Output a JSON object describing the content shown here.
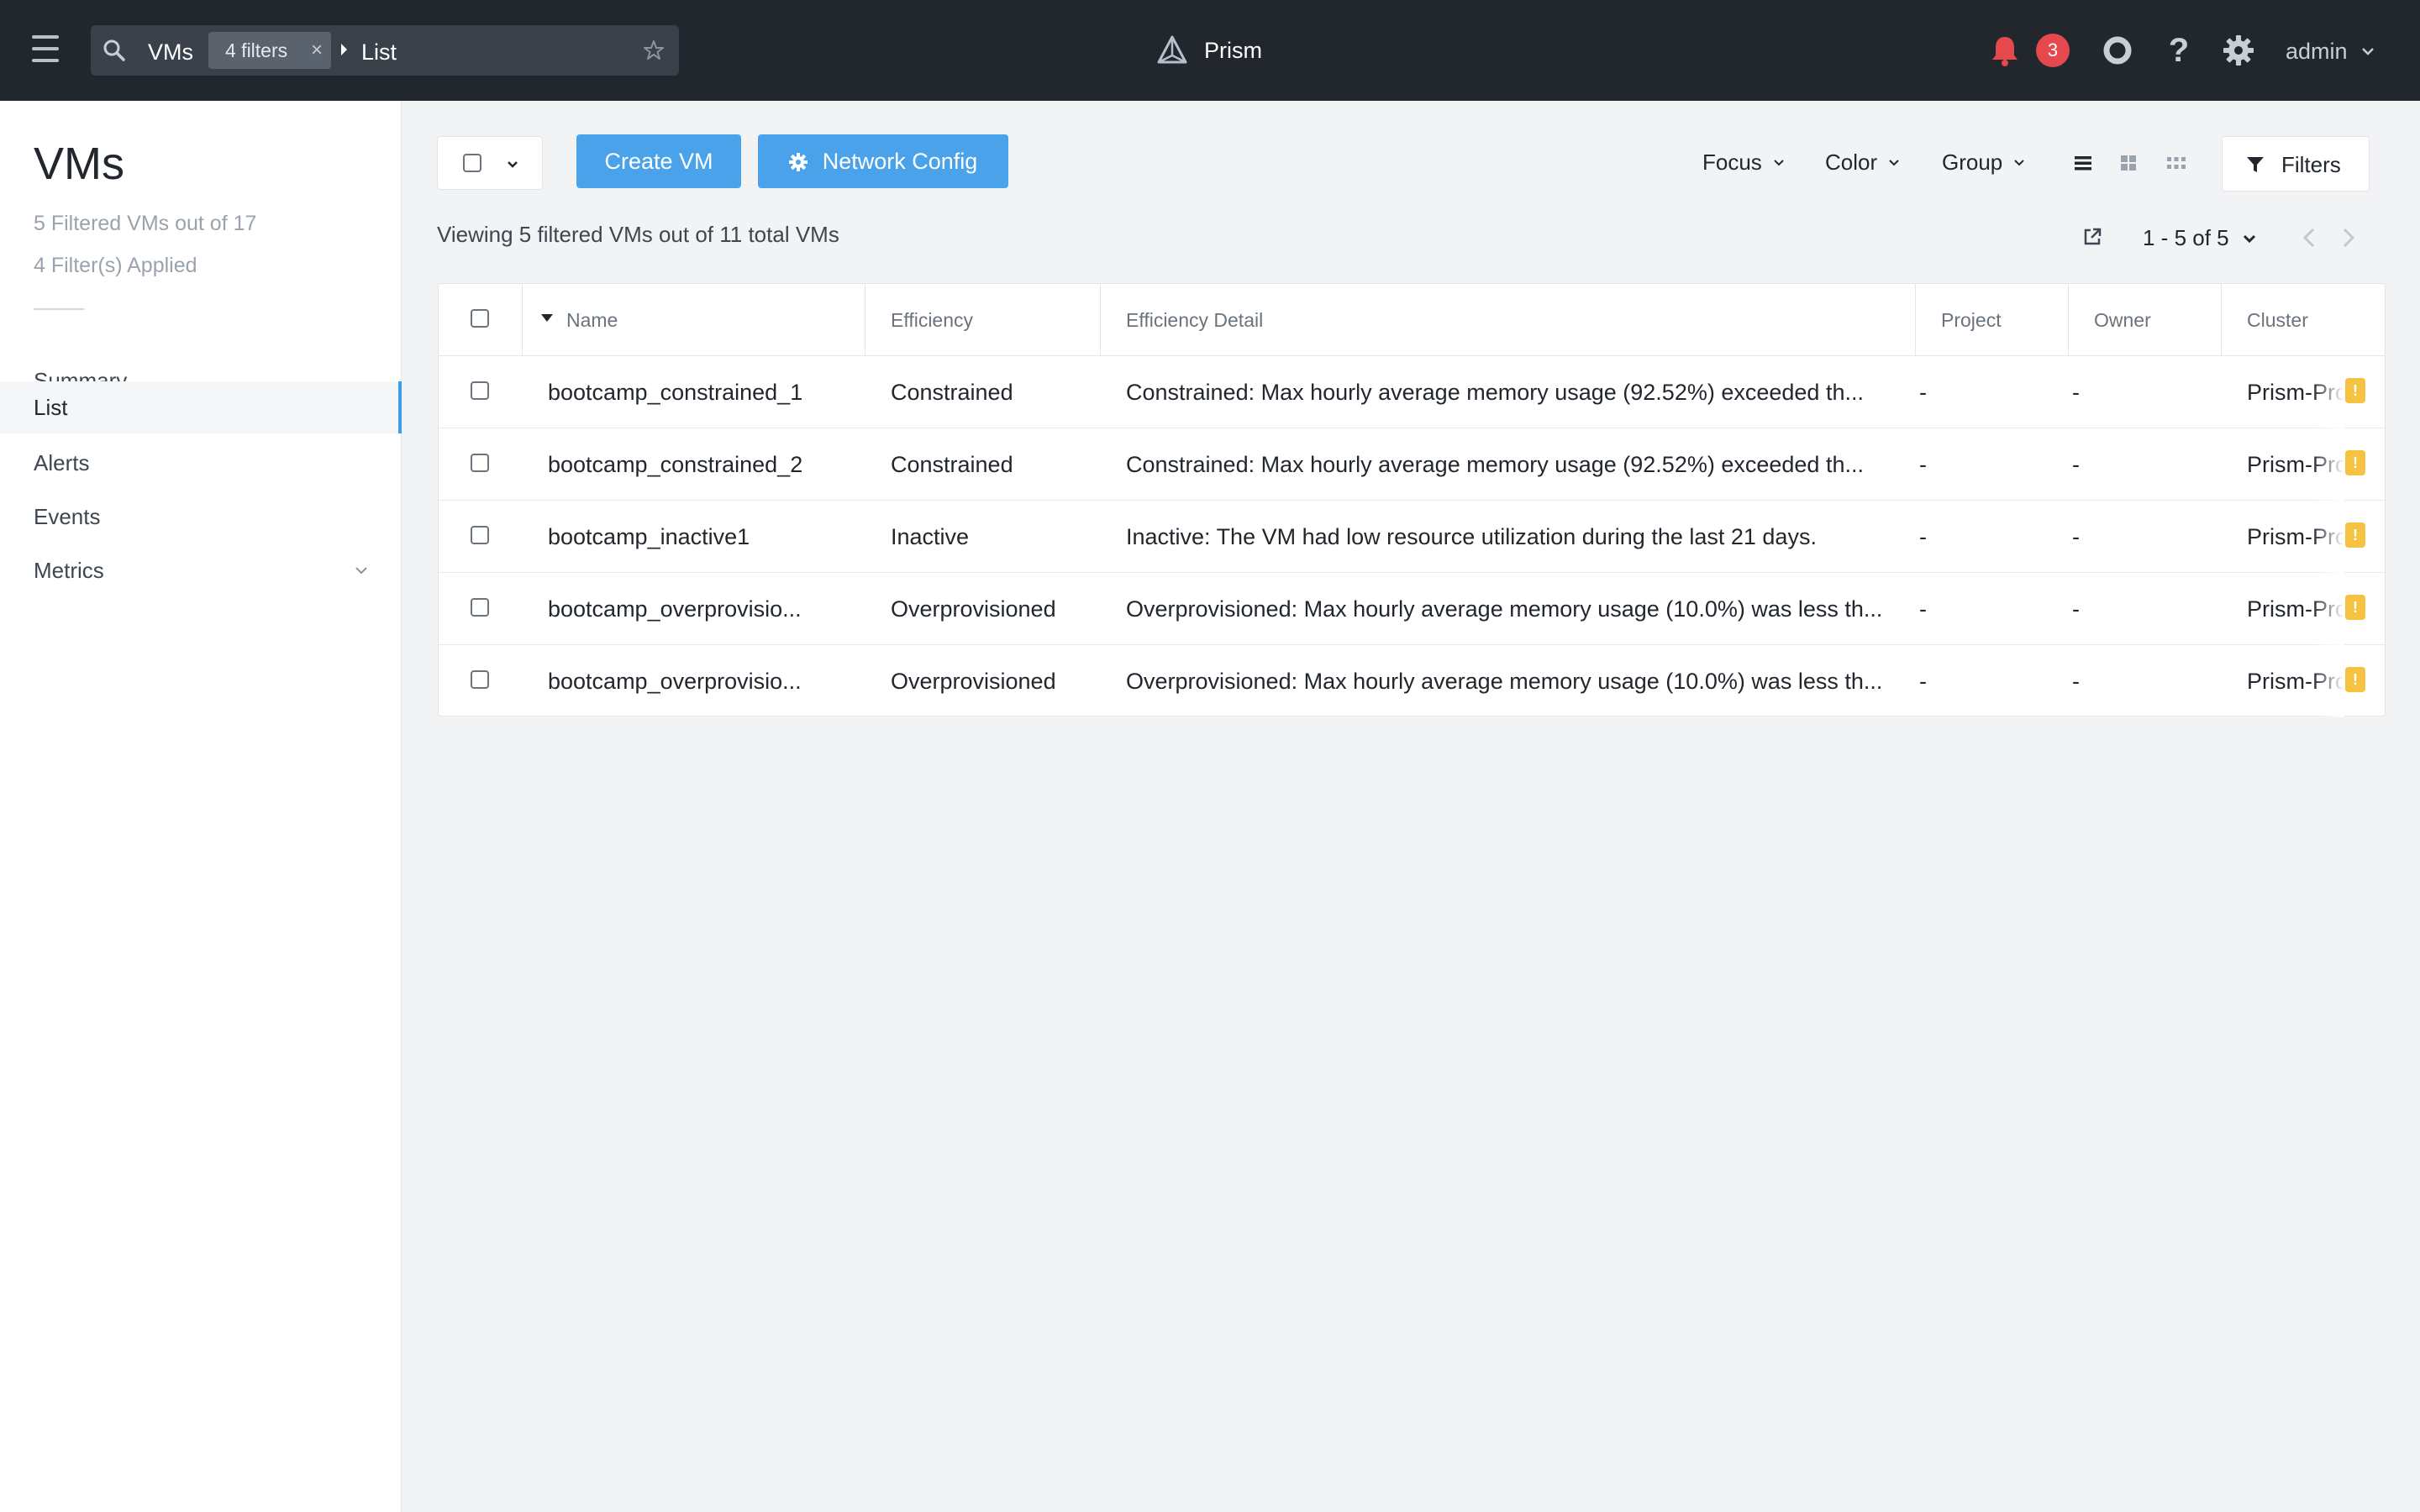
{
  "topbar": {
    "search_scope": "VMs",
    "filter_chip": "4 filters",
    "filter_chip_close": "×",
    "breadcrumb_view": "List",
    "brand": "Prism",
    "alert_count": "3",
    "help_glyph": "?",
    "user": "admin",
    "icons": [
      "hamburger-icon",
      "search-icon",
      "star-icon",
      "prism-logo",
      "bell-icon",
      "ring-icon",
      "help-icon",
      "gear-icon",
      "chevron-down-icon"
    ]
  },
  "sidebar": {
    "title": "VMs",
    "subtitle_filtered": "5 Filtered VMs out of 17",
    "subtitle_filters": "4 Filter(s) Applied",
    "items": [
      {
        "label": "Summary",
        "active": false
      },
      {
        "label": "List",
        "active": true
      },
      {
        "label": "Alerts",
        "active": false
      },
      {
        "label": "Events",
        "active": false
      },
      {
        "label": "Metrics",
        "active": false,
        "expandable": true
      }
    ]
  },
  "toolbar": {
    "create_vm": "Create VM",
    "network_config": "Network Config",
    "focus": "Focus",
    "color": "Color",
    "group": "Group",
    "filters": "Filters",
    "view_modes": [
      "list-view-icon",
      "tile-view-icon",
      "grid-view-icon"
    ],
    "viewing_text": "Viewing 5 filtered VMs out of 11 total VMs",
    "pager_text": "1 - 5 of 5"
  },
  "table": {
    "columns": [
      "Name",
      "Efficiency",
      "Efficiency Detail",
      "Project",
      "Owner",
      "Cluster"
    ],
    "sorted_column": "Name",
    "rows": [
      {
        "name": "bootcamp_constrained_1",
        "efficiency": "Constrained",
        "detail": "Constrained: Max hourly average memory usage (92.52%) exceeded th...",
        "project": "-",
        "owner": "-",
        "cluster": "Prism-Pro",
        "warning": "!"
      },
      {
        "name": "bootcamp_constrained_2",
        "efficiency": "Constrained",
        "detail": "Constrained: Max hourly average memory usage (92.52%) exceeded th...",
        "project": "-",
        "owner": "-",
        "cluster": "Prism-Pro",
        "warning": "!"
      },
      {
        "name": "bootcamp_inactive1",
        "efficiency": "Inactive",
        "detail": "Inactive: The VM had low resource utilization during the last 21 days.",
        "project": "-",
        "owner": "-",
        "cluster": "Prism-Pro",
        "warning": "!"
      },
      {
        "name": "bootcamp_overprovisio...",
        "efficiency": "Overprovisioned",
        "detail": "Overprovisioned: Max hourly average memory usage (10.0%) was less th...",
        "project": "-",
        "owner": "-",
        "cluster": "Prism-Pro",
        "warning": "!"
      },
      {
        "name": "bootcamp_overprovisio...",
        "efficiency": "Overprovisioned",
        "detail": "Overprovisioned: Max hourly average memory usage (10.0%) was less th...",
        "project": "-",
        "owner": "-",
        "cluster": "Prism-Pro",
        "warning": "!"
      }
    ]
  },
  "colors": {
    "topbar_bg": "#22272e",
    "accent": "#4aa3ea",
    "alert": "#e5484d",
    "warning": "#f5c242"
  }
}
